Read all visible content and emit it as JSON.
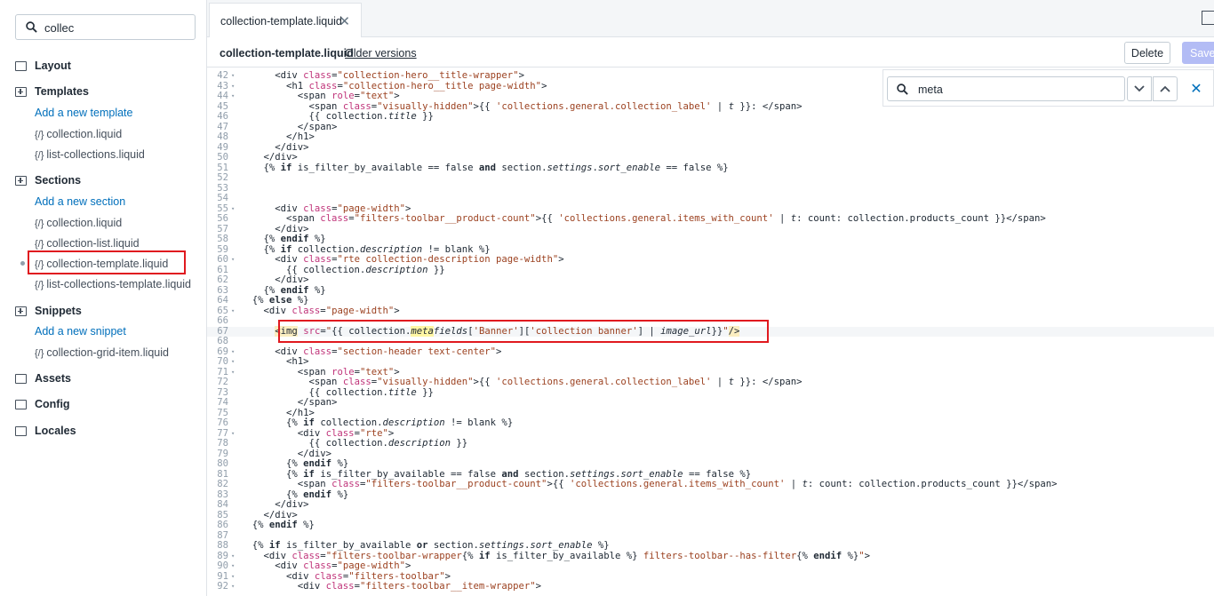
{
  "sidebar": {
    "search_value": "collec",
    "folders": {
      "layout": "Layout",
      "templates": "Templates",
      "sections": "Sections",
      "snippets": "Snippets",
      "assets": "Assets",
      "config": "Config",
      "locales": "Locales"
    },
    "templates": {
      "add": "Add a new template",
      "files": [
        "collection.liquid",
        "list-collections.liquid"
      ]
    },
    "sections": {
      "add": "Add a new section",
      "files": [
        "collection.liquid",
        "collection-list.liquid",
        "collection-template.liquid",
        "list-collections-template.liquid"
      ]
    },
    "snippets": {
      "add": "Add a new snippet",
      "files": [
        "collection-grid-item.liquid"
      ]
    },
    "file_brace": "{/}"
  },
  "tab": {
    "label": "collection-template.liquid",
    "close": "✕"
  },
  "header": {
    "filename": "collection-template.liquid",
    "older_versions": "Older versions",
    "delete": "Delete",
    "save": "Save"
  },
  "find": {
    "value": "meta",
    "down": "⌄",
    "up": "⌃",
    "close": "✕"
  },
  "colors": {
    "highlight_border": "#e0191f",
    "link": "#006fbb",
    "save_disabled": "#b3bcf5"
  },
  "code_lines": [
    {
      "n": "42",
      "fold": true,
      "html": "      &lt;div <span class='attr'>class</span>=<span class='str'>\"collection-hero__title-wrapper\"</span>&gt;"
    },
    {
      "n": "43",
      "fold": true,
      "html": "        &lt;h1 <span class='attr'>class</span>=<span class='str'>\"collection-hero__title page-width\"</span>&gt;"
    },
    {
      "n": "44",
      "fold": true,
      "html": "          &lt;span <span class='attr'>role</span>=<span class='str'>\"text\"</span>&gt;"
    },
    {
      "n": "45",
      "fold": false,
      "html": "            &lt;span <span class='attr'>class</span>=<span class='str'>\"visually-hidden\"</span>&gt;{{ <span class='str'>'collections.general.collection_label'</span> | <span class='it'>t</span> }}: &lt;/span&gt;"
    },
    {
      "n": "46",
      "fold": false,
      "html": "            {{ collection.<span class='it'>title</span> }}"
    },
    {
      "n": "47",
      "fold": false,
      "html": "          &lt;/span&gt;"
    },
    {
      "n": "48",
      "fold": false,
      "html": "        &lt;/h1&gt;"
    },
    {
      "n": "49",
      "fold": false,
      "html": "      &lt;/div&gt;"
    },
    {
      "n": "50",
      "fold": false,
      "html": "    &lt;/div&gt;"
    },
    {
      "n": "51",
      "fold": false,
      "html": "    {% <span class='kw'>if</span> is_filter_by_available == false <span class='kw'>and</span> section.<span class='it'>settings</span>.<span class='it'>sort_enable</span> == false %}"
    },
    {
      "n": "52",
      "fold": false,
      "html": ""
    },
    {
      "n": "53",
      "fold": false,
      "html": ""
    },
    {
      "n": "54",
      "fold": false,
      "html": ""
    },
    {
      "n": "55",
      "fold": true,
      "html": "      &lt;div <span class='attr'>class</span>=<span class='str'>\"page-width\"</span>&gt;"
    },
    {
      "n": "56",
      "fold": false,
      "html": "        &lt;span <span class='attr'>class</span>=<span class='str'>\"filters-toolbar__product-count\"</span>&gt;{{ <span class='str'>'collections.general.items_with_count'</span> | <span class='it'>t</span>: count: collection.products_count }}&lt;/span&gt;"
    },
    {
      "n": "57",
      "fold": false,
      "html": "      &lt;/div&gt;"
    },
    {
      "n": "58",
      "fold": false,
      "html": "    {% <span class='kw'>endif</span> %}"
    },
    {
      "n": "59",
      "fold": false,
      "html": "    {% <span class='kw'>if</span> collection.<span class='it'>description</span> != blank %}"
    },
    {
      "n": "60",
      "fold": true,
      "html": "      &lt;div <span class='attr'>class</span>=<span class='str'>\"rte collection-description page-width\"</span>&gt;"
    },
    {
      "n": "61",
      "fold": false,
      "html": "        {{ collection.<span class='it'>description</span> }}"
    },
    {
      "n": "62",
      "fold": false,
      "html": "      &lt;/div&gt;"
    },
    {
      "n": "63",
      "fold": false,
      "html": "    {% <span class='kw'>endif</span> %}"
    },
    {
      "n": "64",
      "fold": false,
      "html": "  {% <span class='kw'>else</span> %}"
    },
    {
      "n": "65",
      "fold": true,
      "html": "    &lt;div <span class='attr'>class</span>=<span class='str'>\"page-width\"</span>&gt;"
    },
    {
      "n": "66",
      "fold": false,
      "html": ""
    },
    {
      "n": "67",
      "fold": false,
      "html": "      <span class='tag-hl'>&lt;img</span> <span class='attr'>src</span>=<span class='str'>\"</span>{{ collection.<span class='meta-hl'>meta</span><span class='it'>fields</span>[<span class='str'>'Banner'</span>][<span class='str'>'collection banner'</span>] | <span class='it'>image_url</span>}}<span class='str'>\"</span><span class='tag-hl'>/&gt;</span>",
      "active": true
    },
    {
      "n": "68",
      "fold": false,
      "html": ""
    },
    {
      "n": "69",
      "fold": true,
      "html": "      &lt;div <span class='attr'>class</span>=<span class='str'>\"section-header text-center\"</span>&gt;"
    },
    {
      "n": "70",
      "fold": true,
      "html": "        &lt;h1&gt;"
    },
    {
      "n": "71",
      "fold": true,
      "html": "          &lt;span <span class='attr'>role</span>=<span class='str'>\"text\"</span>&gt;"
    },
    {
      "n": "72",
      "fold": false,
      "html": "            &lt;span <span class='attr'>class</span>=<span class='str'>\"visually-hidden\"</span>&gt;{{ <span class='str'>'collections.general.collection_label'</span> | <span class='it'>t</span> }}: &lt;/span&gt;"
    },
    {
      "n": "73",
      "fold": false,
      "html": "            {{ collection.<span class='it'>title</span> }}"
    },
    {
      "n": "74",
      "fold": false,
      "html": "          &lt;/span&gt;"
    },
    {
      "n": "75",
      "fold": false,
      "html": "        &lt;/h1&gt;"
    },
    {
      "n": "76",
      "fold": false,
      "html": "        {% <span class='kw'>if</span> collection.<span class='it'>description</span> != blank %}"
    },
    {
      "n": "77",
      "fold": true,
      "html": "          &lt;div <span class='attr'>class</span>=<span class='str'>\"rte\"</span>&gt;"
    },
    {
      "n": "78",
      "fold": false,
      "html": "            {{ collection.<span class='it'>description</span> }}"
    },
    {
      "n": "79",
      "fold": false,
      "html": "          &lt;/div&gt;"
    },
    {
      "n": "80",
      "fold": false,
      "html": "        {% <span class='kw'>endif</span> %}"
    },
    {
      "n": "81",
      "fold": false,
      "html": "        {% <span class='kw'>if</span> is_filter_by_available == false <span class='kw'>and</span> section.<span class='it'>settings</span>.<span class='it'>sort_enable</span> == false %}"
    },
    {
      "n": "82",
      "fold": false,
      "html": "          &lt;span <span class='attr'>class</span>=<span class='str'>\"filters-toolbar__product-count\"</span>&gt;{{ <span class='str'>'collections.general.items_with_count'</span> | <span class='it'>t</span>: count: collection.products_count }}&lt;/span&gt;"
    },
    {
      "n": "83",
      "fold": false,
      "html": "        {% <span class='kw'>endif</span> %}"
    },
    {
      "n": "84",
      "fold": false,
      "html": "      &lt;/div&gt;"
    },
    {
      "n": "85",
      "fold": false,
      "html": "    &lt;/div&gt;"
    },
    {
      "n": "86",
      "fold": false,
      "html": "  {% <span class='kw'>endif</span> %}"
    },
    {
      "n": "87",
      "fold": false,
      "html": ""
    },
    {
      "n": "88",
      "fold": false,
      "html": "  {% <span class='kw'>if</span> is_filter_by_available <span class='kw'>or</span> section.<span class='it'>settings</span>.<span class='it'>sort_enable</span> %}"
    },
    {
      "n": "89",
      "fold": true,
      "html": "    &lt;div <span class='attr'>class</span>=<span class='str'>\"filters-toolbar-wrapper</span>{% <span class='kw'>if</span> is_filter_by_available %} <span class='str'>filters-toolbar--has-filter</span>{% <span class='kw'>endif</span> %}<span class='str'>\"</span>&gt;"
    },
    {
      "n": "90",
      "fold": true,
      "html": "      &lt;div <span class='attr'>class</span>=<span class='str'>\"page-width\"</span>&gt;"
    },
    {
      "n": "91",
      "fold": true,
      "html": "        &lt;div <span class='attr'>class</span>=<span class='str'>\"filters-toolbar\"</span>&gt;"
    },
    {
      "n": "92",
      "fold": true,
      "html": "          &lt;div <span class='attr'>class</span>=<span class='str'>\"filters-toolbar__item-wrapper\"</span>&gt;"
    }
  ]
}
